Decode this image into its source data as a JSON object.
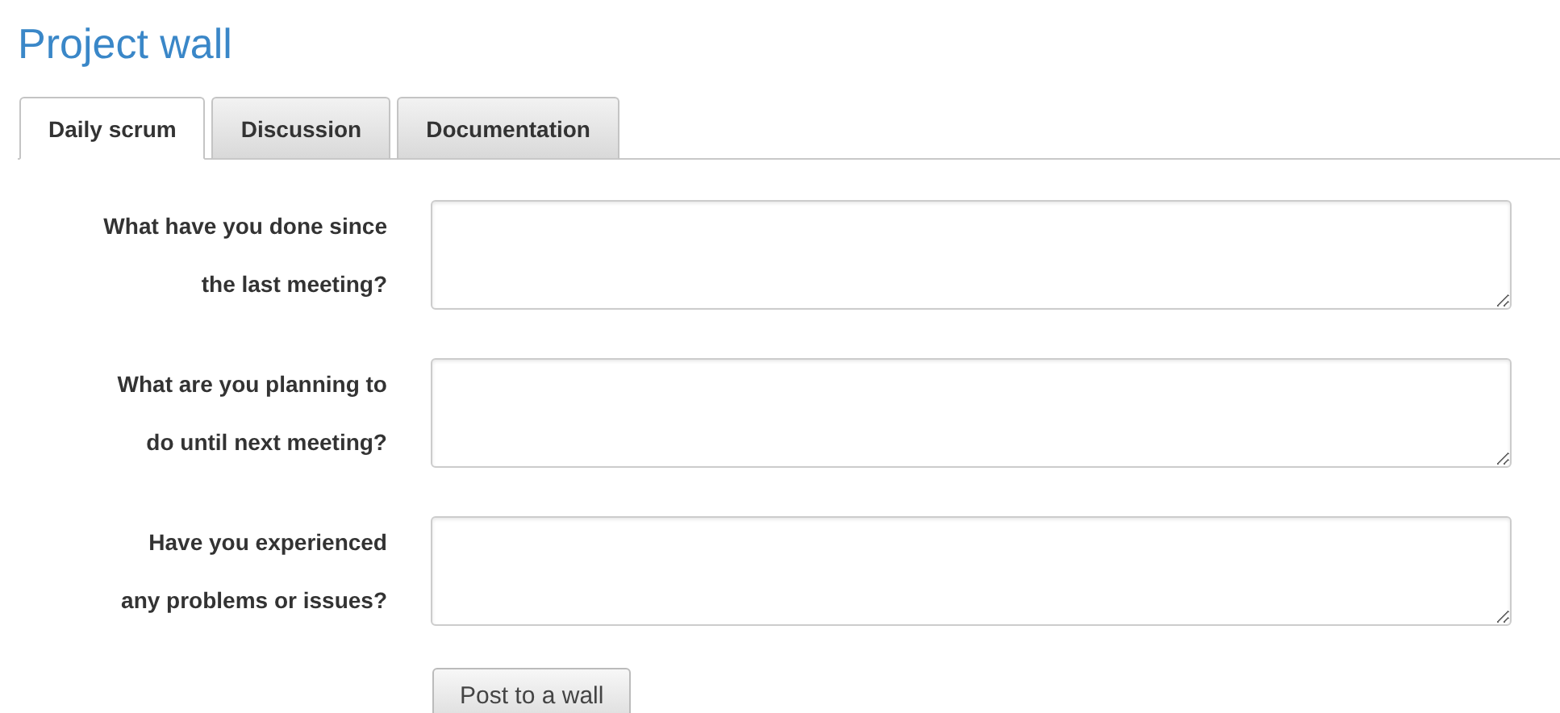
{
  "title": "Project wall",
  "tabs": [
    {
      "label": "Daily scrum",
      "selected": true
    },
    {
      "label": "Discussion",
      "selected": false
    },
    {
      "label": "Documentation",
      "selected": false
    }
  ],
  "questions": [
    {
      "label": "What have you done since\nthe last meeting?"
    },
    {
      "label": "What are you planning to\ndo until next meeting?"
    },
    {
      "label": "Have you experienced\nany problems or issues?"
    }
  ],
  "submit_button": "Post to a wall"
}
